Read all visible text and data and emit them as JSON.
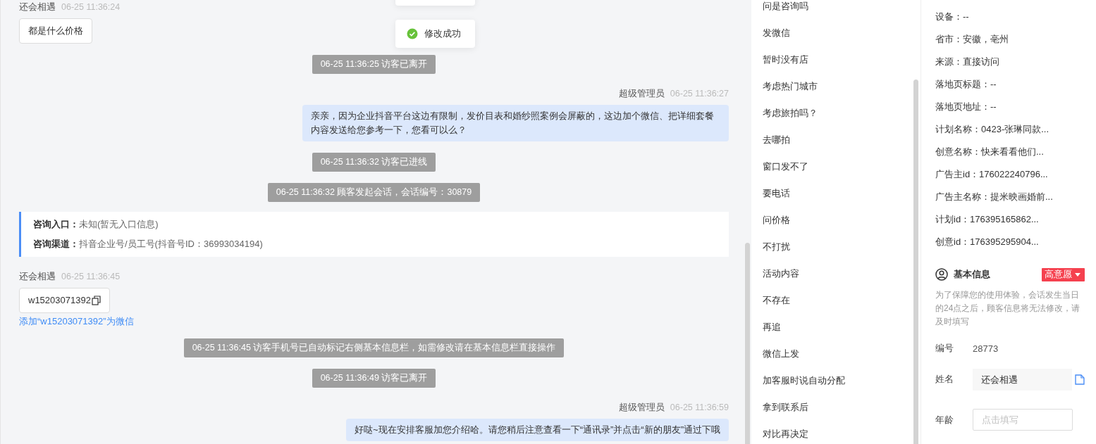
{
  "toasts": [
    {
      "kind": "blank"
    },
    {
      "kind": "success",
      "text": "修改成功"
    }
  ],
  "chat": {
    "messages": [
      {
        "kind": "visitor",
        "sender": "还会相遇",
        "time": "06-25 11:36:24",
        "text": "都是什么价格"
      },
      {
        "kind": "system",
        "text": "06-25 11:36:25 访客已离开"
      },
      {
        "kind": "agent",
        "sender": "超级管理员",
        "time": "06-25 11:36:27",
        "text": "亲亲，因为企业抖音平台这边有限制，发价目表和婚纱照案例会屏蔽的，这边加个微信、把详细套餐内容发送给您参考一下，您看可以么？"
      },
      {
        "kind": "system",
        "text": "06-25 11:36:32 访客已进线"
      },
      {
        "kind": "system",
        "text": "06-25 11:36:32 顾客发起会话，会话编号：30879"
      },
      {
        "kind": "info_card",
        "rows": [
          {
            "label": "咨询入口：",
            "value": "未知(暂无入口信息)"
          },
          {
            "label": "咨询渠道：",
            "value": "抖音企业号/员工号(抖音号ID：36993034194)"
          }
        ]
      },
      {
        "kind": "visitor_copy",
        "sender": "还会相遇",
        "time": "06-25 11:36:45",
        "text": "w15203071392",
        "link": "添加“w15203071392”为微信"
      },
      {
        "kind": "system",
        "text": "06-25 11:36:45 访客手机号已自动标记右侧基本信息栏，如需修改请在基本信息栏直接操作"
      },
      {
        "kind": "system",
        "text": "06-25 11:36:49 访客已离开"
      },
      {
        "kind": "agent",
        "sender": "超级管理员",
        "time": "06-25 11:36:59",
        "text": "好哒~现在安排客服加您介绍哈。请您稍后注意查看一下“通讯录”并点击“新的朋友”通过下哦"
      }
    ]
  },
  "quick_replies": [
    "问是咨询吗",
    "发微信",
    "暂时没有店",
    "考虑热门城市",
    "考虑旅拍吗？",
    "去哪拍",
    "窗口发不了",
    "要电话",
    "问价格",
    "不打扰",
    "活动内容",
    "不存在",
    "再追",
    "微信上发",
    "加客服时说自动分配",
    "拿到联系后",
    "对比再决定"
  ],
  "visitor_info": [
    "设备：--",
    "省市：安徽，亳州",
    "来源：直接访问",
    "落地页标题：--",
    "落地页地址：--",
    "计划名称：0423-张琳同款...",
    "创意名称：快来看看他们...",
    "广告主id：176022240796...",
    "广告主名称：提米映画婚前...",
    "计划id：176395165862...",
    "创意id：176395295904..."
  ],
  "basic_info": {
    "title": "基本信息",
    "tag": "高意愿",
    "note": "为了保障您的使用体验，会话发生当日的24点之后，顾客信息将无法修改，请及时填写",
    "fields": [
      {
        "kind": "static",
        "label": "编号",
        "value": "28773"
      },
      {
        "kind": "filled",
        "label": "姓名",
        "value": "还会相遇"
      },
      {
        "kind": "input",
        "label": "年龄",
        "placeholder": "点击填写"
      }
    ]
  }
}
